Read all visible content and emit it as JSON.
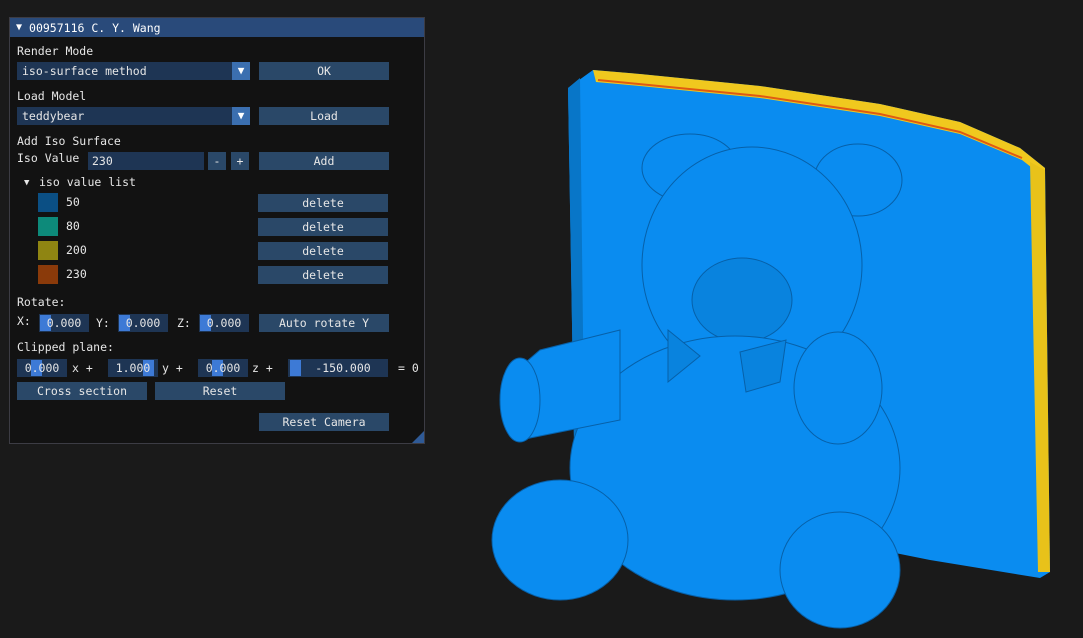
{
  "window": {
    "title": "00957116 C. Y. Wang"
  },
  "render_mode": {
    "label": "Render Mode",
    "value": "iso-surface method",
    "ok_label": "OK"
  },
  "load_model": {
    "label": "Load Model",
    "value": "teddybear",
    "load_label": "Load"
  },
  "add_iso": {
    "label": "Add Iso Surface",
    "iso_value_label": "Iso Value",
    "iso_value": "230",
    "minus_label": "-",
    "plus_label": "+",
    "add_label": "Add"
  },
  "iso_list": {
    "header": "iso value list",
    "items": [
      {
        "value": "50",
        "color": "#0b4f84",
        "delete_label": "delete"
      },
      {
        "value": "80",
        "color": "#0d8a7a",
        "delete_label": "delete"
      },
      {
        "value": "200",
        "color": "#8f8512",
        "delete_label": "delete"
      },
      {
        "value": "230",
        "color": "#8a3a0a",
        "delete_label": "delete"
      }
    ]
  },
  "rotate": {
    "label": "Rotate:",
    "x_label": "X:",
    "x_value": "0.000",
    "y_label": "Y:",
    "y_value": "0.000",
    "z_label": "Z:",
    "z_value": "0.000",
    "auto_label": "Auto rotate Y"
  },
  "clip": {
    "label": "Clipped plane:",
    "a": "0.000",
    "a_suffix": "x +",
    "b": "1.000",
    "b_suffix": "y +",
    "c": "0.000",
    "c_suffix": "z +",
    "d": "-150.000",
    "d_suffix": "= 0",
    "cross_label": "Cross section",
    "reset_label": "Reset"
  },
  "camera": {
    "reset_label": "Reset Camera"
  },
  "colors": {
    "title_bar": "#294a7a",
    "button": "#2a4868",
    "frame": "#1e3554",
    "accent": "#3d7ad6",
    "model": "#0a8cf0",
    "inner": "#f0c81e"
  }
}
